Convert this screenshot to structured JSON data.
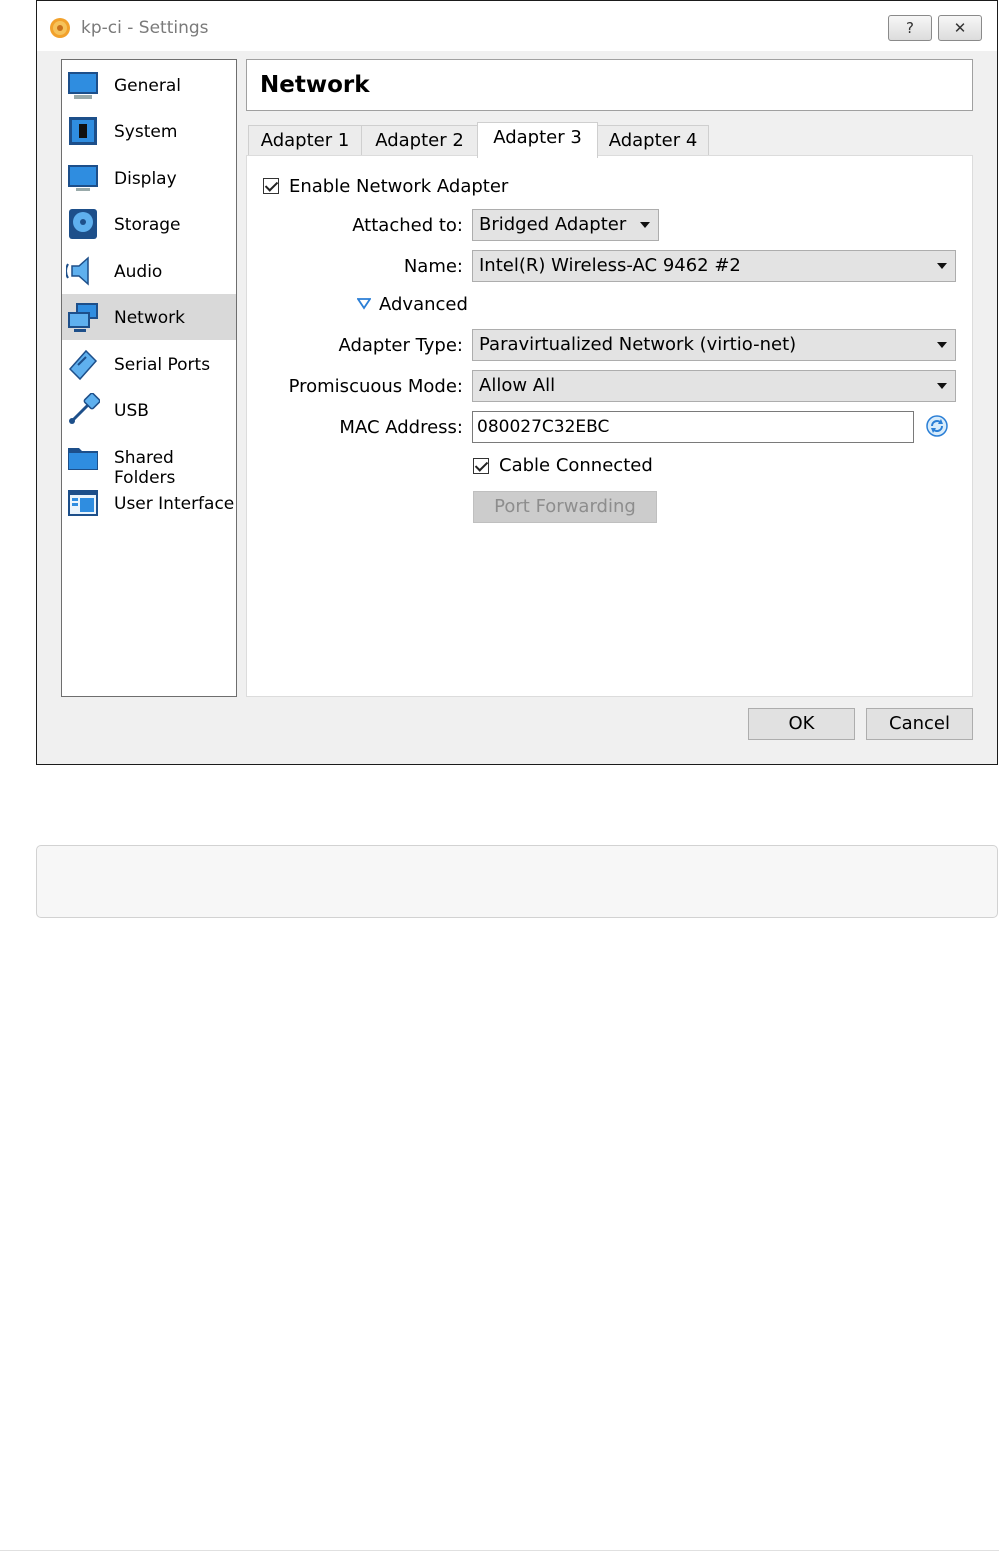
{
  "window": {
    "title": "kp-ci - Settings",
    "help_button": "?",
    "close_button": "✕"
  },
  "sidebar": {
    "items": [
      {
        "label": "General",
        "icon": "general-icon"
      },
      {
        "label": "System",
        "icon": "system-icon"
      },
      {
        "label": "Display",
        "icon": "display-icon"
      },
      {
        "label": "Storage",
        "icon": "storage-icon"
      },
      {
        "label": "Audio",
        "icon": "audio-icon"
      },
      {
        "label": "Network",
        "icon": "network-icon",
        "selected": true
      },
      {
        "label": "Serial Ports",
        "icon": "serial-ports-icon"
      },
      {
        "label": "USB",
        "icon": "usb-icon"
      },
      {
        "label": "Shared Folders",
        "icon": "shared-folders-icon"
      },
      {
        "label": "User Interface",
        "icon": "user-interface-icon"
      }
    ]
  },
  "header": {
    "title": "Network"
  },
  "tabs": [
    {
      "label": "Adapter 1"
    },
    {
      "label": "Adapter 2"
    },
    {
      "label": "Adapter 3",
      "active": true
    },
    {
      "label": "Adapter 4"
    }
  ],
  "form": {
    "enable_adapter": {
      "label": "Enable Network Adapter",
      "checked": true
    },
    "attached_to": {
      "label": "Attached to:",
      "value": "Bridged Adapter"
    },
    "name": {
      "label": "Name:",
      "value": "Intel(R) Wireless-AC 9462 #2"
    },
    "advanced": {
      "label": "Advanced",
      "expanded": true
    },
    "adapter_type": {
      "label": "Adapter Type:",
      "value": "Paravirtualized Network (virtio-net)"
    },
    "promiscuous_mode": {
      "label": "Promiscuous Mode:",
      "value": "Allow All"
    },
    "mac_address": {
      "label": "MAC Address:",
      "value": "080027C32EBC"
    },
    "cable_connected": {
      "label": "Cable Connected",
      "checked": true
    },
    "port_forwarding": {
      "label": "Port Forwarding",
      "enabled": false
    }
  },
  "footer": {
    "ok": "OK",
    "cancel": "Cancel"
  },
  "colors": {
    "accent": "#2b7fd6",
    "selected_bg": "#d9d9d9",
    "window_bg": "#f0f0f0"
  }
}
